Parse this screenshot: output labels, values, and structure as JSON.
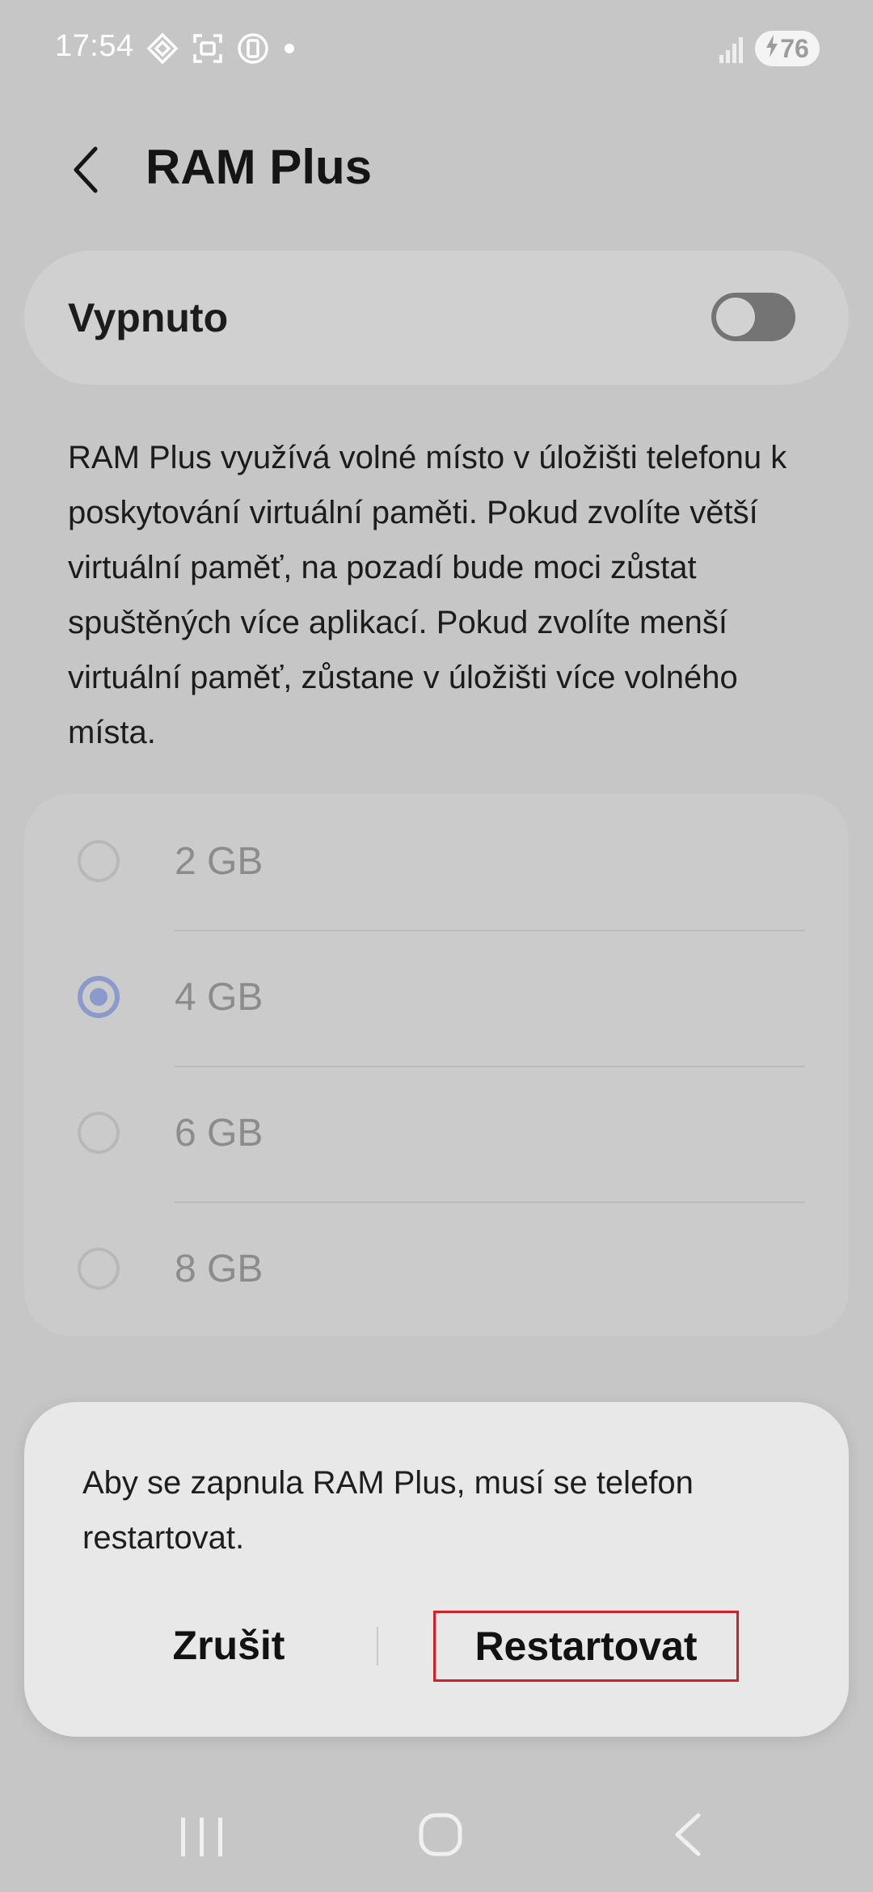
{
  "status_bar": {
    "time": "17:54",
    "battery_level": "76",
    "icons": [
      "sync-icon",
      "screenshot-icon",
      "device-care-icon",
      "notification-dot-icon",
      "signal-icon",
      "charging-icon"
    ]
  },
  "header": {
    "title": "RAM Plus",
    "back_icon": "chevron-left-icon"
  },
  "master_switch": {
    "label": "Vypnuto",
    "enabled": false
  },
  "description": "RAM Plus využívá volné místo v úložišti telefonu k poskytování virtuální paměti. Pokud zvolíte větší virtuální paměť, na pozadí bude moci zůstat spuštěných více aplikací. Pokud zvolíte menší virtuální paměť, zůstane v úložišti více volného místa.",
  "options": [
    {
      "label": "2 GB",
      "selected": false
    },
    {
      "label": "4 GB",
      "selected": true
    },
    {
      "label": "6 GB",
      "selected": false
    },
    {
      "label": "8 GB",
      "selected": false
    }
  ],
  "dialog": {
    "message": "Aby se zapnula RAM Plus, musí se telefon restartovat.",
    "cancel_label": "Zrušit",
    "confirm_label": "Restartovat"
  },
  "colors": {
    "accent": "#8a9acb",
    "highlight_border": "#d0202a",
    "dim_background": "#c6c6c6"
  },
  "nav_bar": {
    "icons": [
      "recent-apps-icon",
      "home-icon",
      "back-icon"
    ]
  }
}
